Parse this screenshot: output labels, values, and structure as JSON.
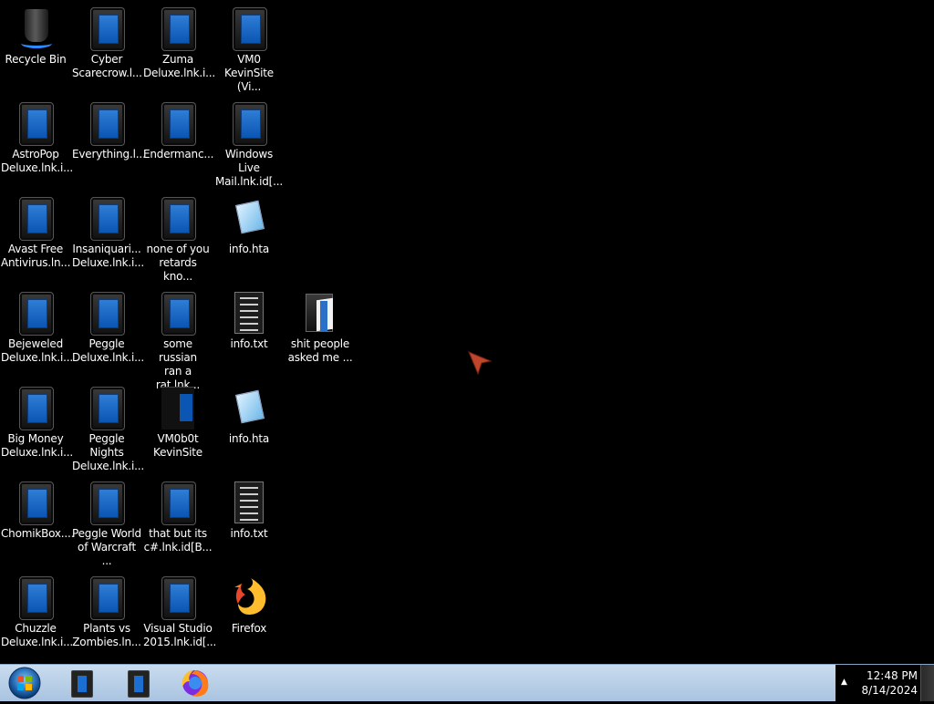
{
  "desktop": {
    "icons": [
      {
        "label": "Recycle Bin",
        "type": "recycle-bin"
      },
      {
        "label": "Cyber\nScarecrow.l...",
        "type": "app"
      },
      {
        "label": "Zuma\nDeluxe.lnk.i...",
        "type": "app"
      },
      {
        "label": "VM0\nKevinSite (Vi...",
        "type": "app"
      },
      {
        "label": "AstroPop\nDeluxe.lnk.i...",
        "type": "app"
      },
      {
        "label": "Everything.l...",
        "type": "app"
      },
      {
        "label": "Endermanc...",
        "type": "app"
      },
      {
        "label": "Windows Live\nMail.lnk.id[...",
        "type": "app"
      },
      {
        "label": "Avast Free\nAntivirus.ln...",
        "type": "app"
      },
      {
        "label": "Insaniquari...\nDeluxe.lnk.i...",
        "type": "app"
      },
      {
        "label": "none of you\nretards kno...",
        "type": "app"
      },
      {
        "label": "info.hta",
        "type": "hta"
      },
      {
        "label": "Bejeweled\nDeluxe.lnk.i...",
        "type": "app"
      },
      {
        "label": "Peggle\nDeluxe.lnk.i...",
        "type": "app"
      },
      {
        "label": "some russian\nran a rat.lnk...",
        "type": "app"
      },
      {
        "label": "info.txt",
        "type": "txt"
      },
      {
        "label": "shit people\nasked me ...",
        "type": "folder"
      },
      {
        "label": "Big Money\nDeluxe.lnk.i...",
        "type": "app"
      },
      {
        "label": "Peggle Nights\nDeluxe.lnk.i...",
        "type": "app"
      },
      {
        "label": "VM0b0t\nKevinSite",
        "type": "partial"
      },
      {
        "label": "info.hta",
        "type": "hta"
      },
      {
        "label": "ChomikBox....",
        "type": "app"
      },
      {
        "label": "Peggle World\nof Warcraft ...",
        "type": "app"
      },
      {
        "label": "that but its\nc#.lnk.id[B...",
        "type": "app"
      },
      {
        "label": "info.txt",
        "type": "txt"
      },
      {
        "label": "Chuzzle\nDeluxe.lnk.i...",
        "type": "app"
      },
      {
        "label": "Plants vs\nZombies.ln...",
        "type": "app"
      },
      {
        "label": "Visual Studio\n2015.lnk.id[...",
        "type": "app"
      },
      {
        "label": "Firefox",
        "type": "firefox"
      }
    ]
  },
  "taskbar": {
    "pinned": [
      {
        "name": "app-window-1",
        "icon": "app-icon"
      },
      {
        "name": "app-window-2",
        "icon": "app-icon"
      },
      {
        "name": "firefox",
        "icon": "firefox-icon"
      }
    ],
    "tray": {
      "time": "12:48 PM",
      "date": "8/14/2024"
    }
  },
  "colors": {
    "desktop_bg": "#000000",
    "taskbar_bg": "#b7cde6",
    "icon_blue": "#1a6fd0"
  }
}
